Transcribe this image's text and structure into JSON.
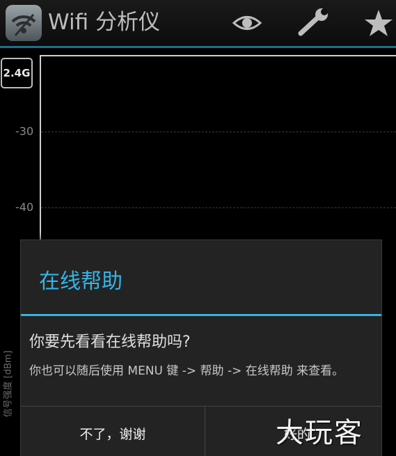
{
  "app_bar": {
    "title": "Wifi 分析仪",
    "accent_color": "#1b6f91",
    "icons": [
      "wifi-logo-icon",
      "eye-icon",
      "wrench-icon",
      "star-icon"
    ]
  },
  "graph": {
    "band_label": "2.4G",
    "y_ticks": [
      "-30",
      "-40"
    ],
    "y_axis_label": "信号强度 [dBm]"
  },
  "dialog": {
    "title": "在线帮助",
    "accent_color": "#33b5e5",
    "message": "你要先看看在线帮助吗?",
    "detail": "你也可以随后使用 MENU 键 -> 帮助 -> 在线帮助 来查看。",
    "negative_button": "不了，谢谢",
    "positive_button": "好的"
  },
  "watermark": "大玩客"
}
